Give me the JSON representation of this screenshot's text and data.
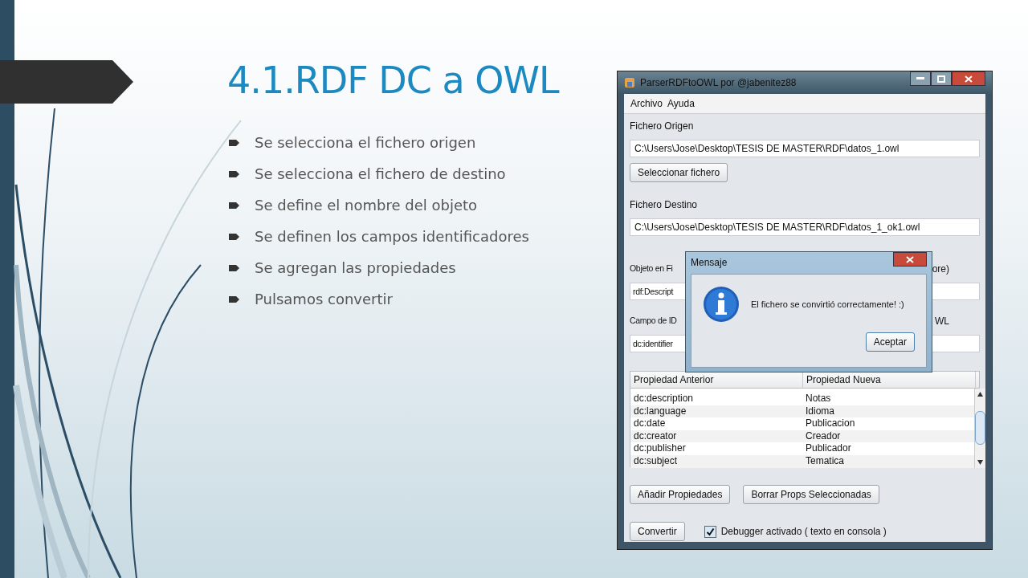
{
  "slide": {
    "title": "4.1.RDF DC a OWL",
    "bullets": [
      "Se selecciona el fichero origen",
      "Se selecciona el fichero de destino",
      "Se define el nombre del objeto",
      "Se definen los campos identificadores",
      "Se agregan las propiedades",
      "Pulsamos convertir"
    ]
  },
  "window": {
    "title": "ParserRDFtoOWL por @jabenitez88",
    "menu": [
      "Archivo",
      "Ayuda"
    ],
    "source": {
      "label": "Fichero Origen",
      "value": "C:\\Users\\Jose\\Desktop\\TESIS DE MASTER\\RDF\\datos_1.owl",
      "button": "Seleccionar fichero"
    },
    "destination": {
      "label": "Fichero Destino",
      "value": "C:\\Users\\Jose\\Desktop\\TESIS DE MASTER\\RDF\\datos_1_ok1.owl"
    },
    "object": {
      "label_start": "Objeto en Fi",
      "label_end": "ore)",
      "value": "rdf:Descript"
    },
    "id_field": {
      "label_start": "Campo de ID",
      "label_end": "WL",
      "value": "dc:identifier"
    },
    "table": {
      "columns": [
        "Propiedad Anterior",
        "Propiedad Nueva"
      ],
      "rows": [
        [
          "dc:description",
          "Notas"
        ],
        [
          "dc:language",
          "Idioma"
        ],
        [
          "dc:date",
          "Publicacion"
        ],
        [
          "dc:creator",
          "Creador"
        ],
        [
          "dc:publisher",
          "Publicador"
        ],
        [
          "dc:subject",
          "Tematica"
        ]
      ]
    },
    "buttons": [
      "Añadir Propiedades",
      "Borrar Props Seleccionadas"
    ],
    "convert_button": "Convertir",
    "debugger": {
      "label": "Debugger activado ( texto en consola )",
      "checked": true
    }
  },
  "dialog": {
    "title": "Mensaje",
    "message": "El fichero se convirtió correctamente! :)",
    "button": "Aceptar"
  }
}
